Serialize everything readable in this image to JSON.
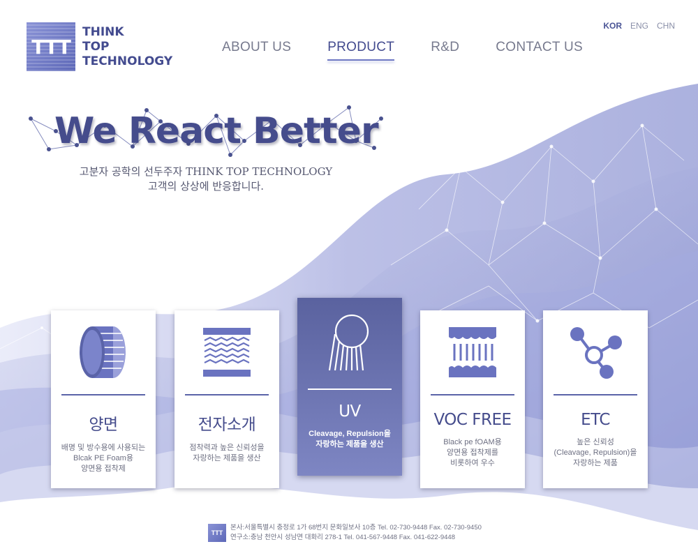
{
  "brand": {
    "mark": "TTT",
    "lines": [
      "THINK",
      "TOP",
      "TECHNOLOGY"
    ]
  },
  "languages": [
    {
      "label": "KOR",
      "active": true
    },
    {
      "label": "ENG",
      "active": false
    },
    {
      "label": "CHN",
      "active": false
    }
  ],
  "nav": {
    "items": [
      {
        "label": "ABOUT US",
        "active": false
      },
      {
        "label": "PRODUCT",
        "active": true
      },
      {
        "label": "R&D",
        "active": false
      },
      {
        "label": "CONTACT US",
        "active": false
      }
    ]
  },
  "hero": {
    "title": "We React Better",
    "subtitle_line1": "고분자 공학의 선두주자 THINK TOP TECHNOLOGY",
    "subtitle_line2": "고객의 상상에 반응합니다."
  },
  "cards": [
    {
      "title": "양면",
      "desc": [
        "배명 및 방수용에 사용되는",
        "Blcak PE Foam용",
        "양면용 접착제"
      ],
      "icon": "roll-icon",
      "active": false
    },
    {
      "title": "전자소개",
      "desc": [
        "점착력과 높은 신뢰성을",
        "자랑하는 제품을 생산"
      ],
      "icon": "layers-icon",
      "active": false
    },
    {
      "title": "UV",
      "desc": [
        "Cleavage, Repulsion을",
        "자랑하는 제품을 생산"
      ],
      "icon": "uv-icon",
      "active": true
    },
    {
      "title": "VOC FREE",
      "desc": [
        "Black pe fOAM용",
        "양면용 접착제를",
        "비롯하여 우수"
      ],
      "icon": "foam-icon",
      "active": false
    },
    {
      "title": "ETC",
      "desc": [
        "높은 신뢰성",
        "(Cleavage, Repulsion)을",
        "자랑하는 제품"
      ],
      "icon": "molecule-icon",
      "active": false
    }
  ],
  "footer": {
    "mark": "TTT",
    "line1": "본사:서울특별시 충정로 1가 68번지 문화일보사 10층   Tel. 02-730-9448   Fax. 02-730-9450",
    "line2": "연구소:충남 천안시 성남면 대화리 278-1    Tel. 041-567-9448     Fax. 041-622-9448"
  },
  "colors": {
    "primary": "#454c8c",
    "accent": "#6d77c3",
    "wave": "#8f96d6"
  }
}
